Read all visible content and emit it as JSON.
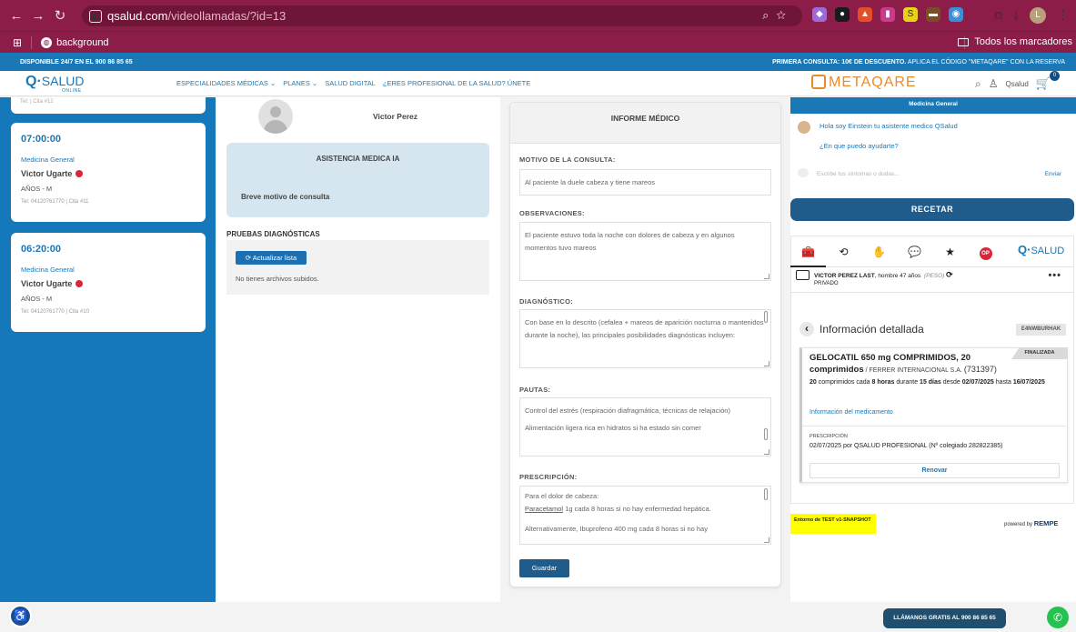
{
  "browser": {
    "url_host": "qsalud.com",
    "url_path": "/videollamadas/?id=13",
    "bookmark_label": "background",
    "all_bookmarks": "Todos los marcadores",
    "profile_initial": "L"
  },
  "site": {
    "top_left": "DISPONIBLE 24/7 EN EL 900 86 85 65",
    "top_right_bold": "PRIMERA CONSULTA: 10€ DE DESCUENTO.",
    "top_right_rest": " APLICA EL CÓDIGO \"METAQARE\" CON LA RESERVA",
    "logo": "SALUD",
    "logo_sub": "ONLINE",
    "nav": [
      "ESPECIALIDADES MÉDICAS ⌄",
      "PLANES ⌄",
      "SALUD DIGITAL",
      "¿ERES PROFESIONAL DE LA SALUD? ÚNETE"
    ],
    "partner": "METAQARE",
    "user": "Qsalud",
    "cart_count": "0"
  },
  "appointments": {
    "top_tel": "Tel: | Cita #12",
    "items": [
      {
        "time": "07:00:00",
        "specialty": "Medicina General",
        "name": "Victor Ugarte",
        "age": "AÑOS - M",
        "tel": "Tel: 04120761770 | Cita #11"
      },
      {
        "time": "06:20:00",
        "specialty": "Medicina General",
        "name": "Victor Ugarte",
        "age": "AÑOS - M",
        "tel": "Tel: 04120761770 | Cita #10"
      }
    ]
  },
  "patient": {
    "name": "Victor Perez"
  },
  "ia": {
    "title": "ASISTENCIA MEDICA IA",
    "subtitle": "Breve motivo de consulta"
  },
  "pruebas": {
    "title": "PRUEBAS DIAGNÓSTICAS",
    "button": "⟳ Actualizar lista",
    "empty": "No tienes archivos subidos."
  },
  "informe": {
    "title": "INFORME MÉDICO",
    "motivo_label": "MOTIVO DE LA CONSULTA:",
    "motivo_value": "Al paciente la duele cabeza y tiene mareos",
    "obs_label": "OBSERVACIONES:",
    "obs_value": "El paciente estuvo toda la noche con dolores de cabeza y en algunos momentos tuvo mareos",
    "diag_label": "DIAGNÓSTICO:",
    "diag_value": "Con base en lo descrito (cefalea + mareos de aparición nocturna o mantenidos durante la noche), las principales posibilidades diagnósticas incluyen:",
    "pautas_label": "PAUTAS:",
    "pautas_value1": "Control del estrés (respiración diafragmática, técnicas de relajación)",
    "pautas_value2": "Alimentación ligera rica en hidratos si ha estado sin comer",
    "presc_label": "PRESCRIPCIÓN:",
    "presc_line1": "Para el dolor de cabeza:",
    "presc_drug": "Paracetamol",
    "presc_line2": " 1g cada 8 horas si no hay enfermedad hepática.",
    "presc_line3": "Alternativamente, Ibuprofeno 400 mg cada 8 horas si no hay",
    "save": "Guardar"
  },
  "chat": {
    "header": "Medicina General",
    "msg1": "Hola soy Einstein tu asistente medico QSalud",
    "msg2": "¿En que puedo ayudarte?",
    "placeholder": "Escribe tus síntomas o dudas...",
    "send": "Enviar"
  },
  "recetar": "RECETAR",
  "rempe": {
    "tabs": [
      "🧰",
      "⟲",
      "✋",
      "💬",
      "★",
      "OP"
    ],
    "patient_name": "VICTOR PEREZ LAST",
    "patient_info": ", hombre 47 años",
    "peso": "(PESO)",
    "coverage": "PRIVADO",
    "info_title": "Información detallada",
    "info_code": "E4NWBURHAK",
    "status": "FINALIZADA",
    "med_name": "GELOCATIL 650 mg COMPRIMIDOS, 20 comprimidos",
    "med_lab": " / FERRER INTERNACIONAL S.A. ",
    "med_code": "(731397)",
    "dose_qty": "20",
    "dose_t1": " comprimidos cada ",
    "dose_freq": "8 horas",
    "dose_t2": " durante ",
    "dose_dur": "15 días",
    "dose_t3": " desde ",
    "dose_from": "02/07/2025",
    "dose_t4": " hasta ",
    "dose_to": "16/07/2025",
    "med_link": "Información del medicamento",
    "presc_label": "PRESCRIPCIÓN",
    "presc_text": "02/07/2025 por QSALUD PROFESIONAL (Nº colegiado 282822385)",
    "renew": "Renovar",
    "env_note": "Entorno de TEST v1-SNAPSHOT",
    "powered": "powered by",
    "powered_brand": "REMPE"
  },
  "footer": {
    "call": "LLÁMANOS GRATIS AL 900 86 85 65"
  }
}
